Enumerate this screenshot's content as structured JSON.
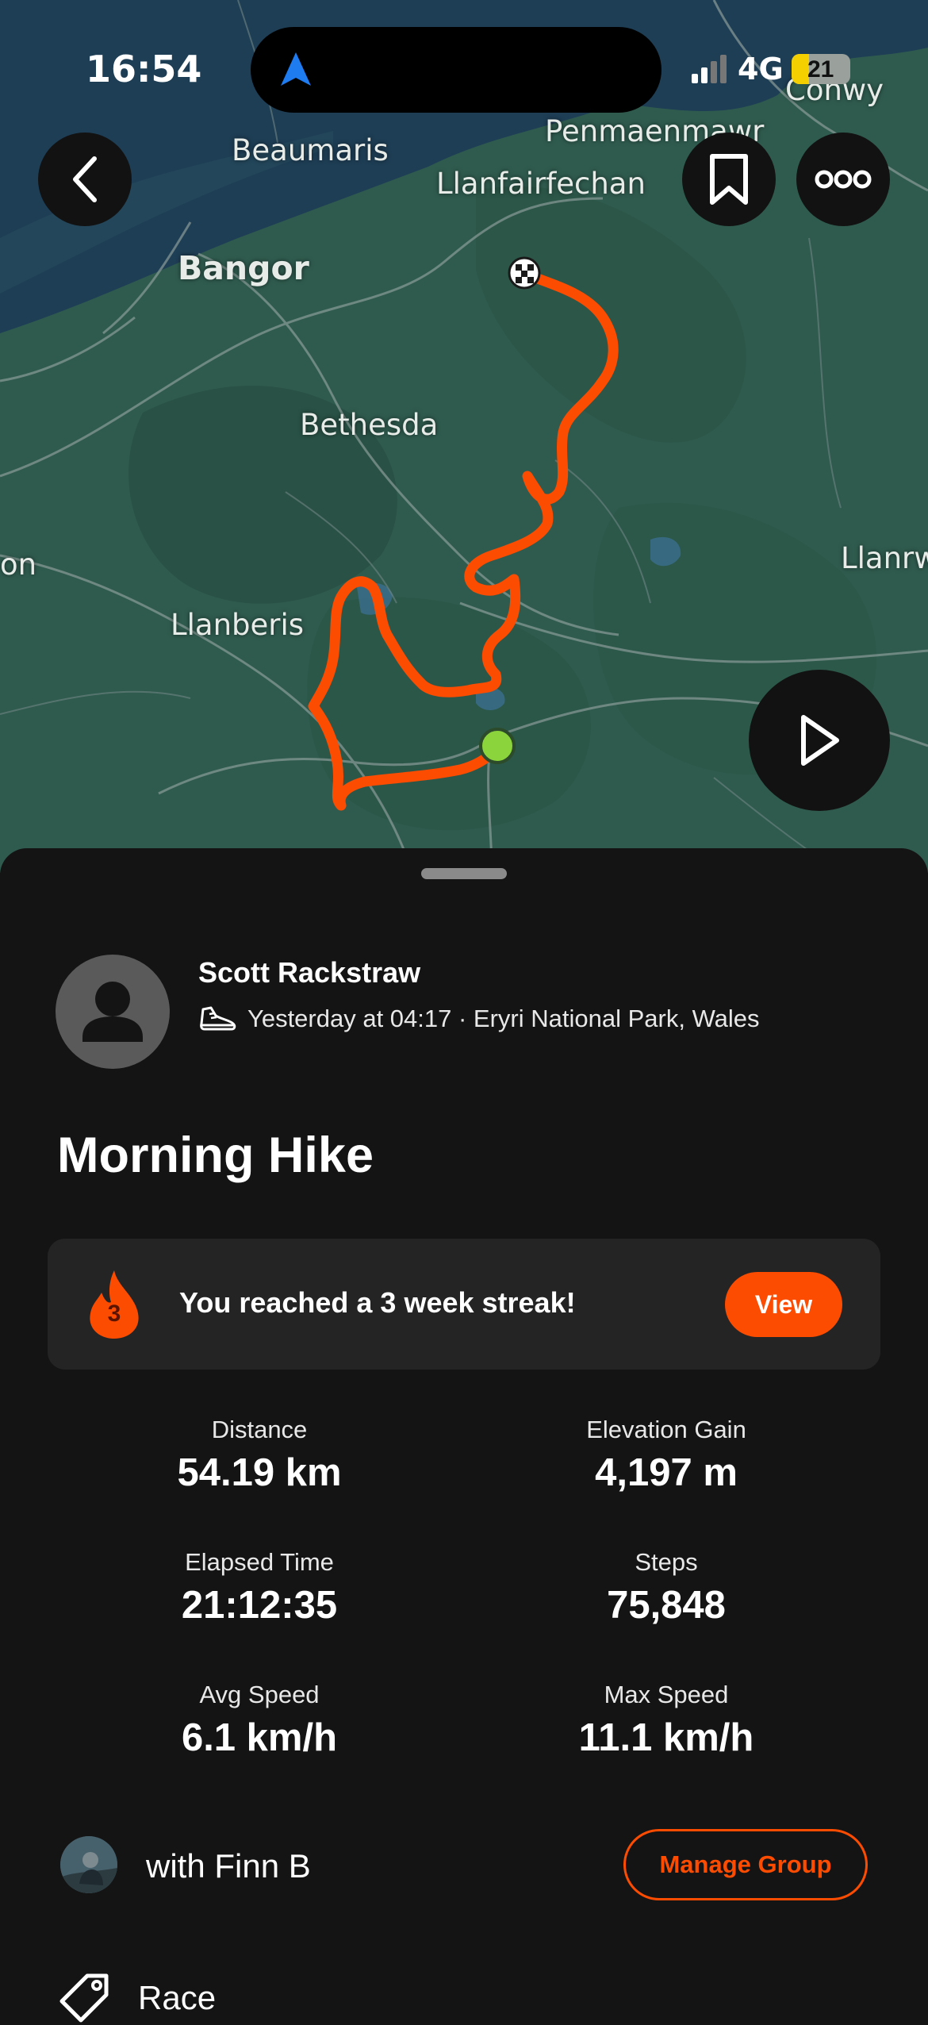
{
  "status_bar": {
    "time": "16:54",
    "network": "4G",
    "battery": "21"
  },
  "map": {
    "labels": {
      "beaumaris": "Beaumaris",
      "penmaenmawr": "Penmaenmawr",
      "conwy": "Conwy",
      "llanfairfechan": "Llanfairfechan",
      "bangor": "Bangor",
      "bethesda": "Bethesda",
      "llanberis": "Llanberis",
      "llanrwst_partial": "Llanrw",
      "left_partial": "on"
    },
    "route_color": "#fc4c02",
    "start_color": "#8bd43c"
  },
  "activity": {
    "athlete_name": "Scott Rackstraw",
    "meta": "Yesterday at 04:17 · Eryri National Park, Wales",
    "title": "Morning Hike"
  },
  "streak": {
    "count": "3",
    "message": "You reached a 3 week streak!",
    "button_label": "View"
  },
  "stats": {
    "distance": {
      "label": "Distance",
      "value": "54.19 km"
    },
    "elevation_gain": {
      "label": "Elevation Gain",
      "value": "4,197 m"
    },
    "elapsed_time": {
      "label": "Elapsed Time",
      "value": "21:12:35"
    },
    "steps": {
      "label": "Steps",
      "value": "75,848"
    },
    "avg_speed": {
      "label": "Avg Speed",
      "value": "6.1 km/h"
    },
    "max_speed": {
      "label": "Max Speed",
      "value": "11.1 km/h"
    }
  },
  "group": {
    "text": "with Finn B",
    "button_label": "Manage Group"
  },
  "race": {
    "label": "Race"
  },
  "colors": {
    "accent": "#fc4c02",
    "background": "#141414",
    "card": "#242424"
  }
}
